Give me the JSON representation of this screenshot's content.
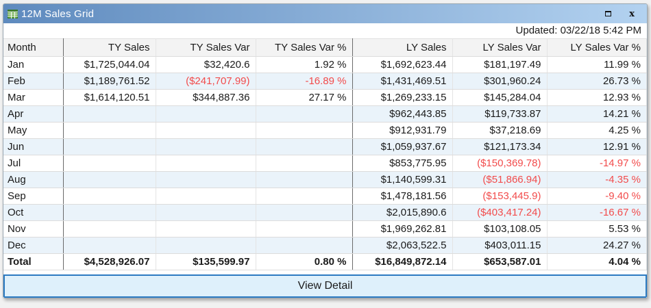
{
  "window": {
    "title": "12M Sales Grid",
    "updated": "Updated: 03/22/18 5:42 PM",
    "view_detail_label": "View Detail",
    "icons": {
      "title_icon": "spreadsheet-grid-icon",
      "maximize_icon": "maximize-icon",
      "close_icon": "close-icon",
      "close_glyph": "x"
    }
  },
  "colors": {
    "titlebar_gradient_start": "#5e8abe",
    "titlebar_gradient_end": "#b3d2f0",
    "negative_text": "#f24b4b",
    "zebra_row_bg": "#eaf3fa",
    "header_row_bg": "#f3f3f3",
    "button_border": "#2b7ac1",
    "button_bg": "#def0fb",
    "group_separator": "#6a6a6a",
    "icon_green": "#3f7d2e"
  },
  "table": {
    "columns": [
      "Month",
      "TY Sales",
      "TY Sales Var",
      "TY Sales Var %",
      "LY Sales",
      "LY Sales Var",
      "LY Sales Var %"
    ],
    "rows": [
      [
        "Jan",
        "$1,725,044.04",
        "$32,420.6",
        "1.92 %",
        "$1,692,623.44",
        "$181,197.49",
        "11.99 %"
      ],
      [
        "Feb",
        "$1,189,761.52",
        "($241,707.99)",
        "-16.89 %",
        "$1,431,469.51",
        "$301,960.24",
        "26.73 %"
      ],
      [
        "Mar",
        "$1,614,120.51",
        "$344,887.36",
        "27.17 %",
        "$1,269,233.15",
        "$145,284.04",
        "12.93 %"
      ],
      [
        "Apr",
        "",
        "",
        "",
        "$962,443.85",
        "$119,733.87",
        "14.21 %"
      ],
      [
        "May",
        "",
        "",
        "",
        "$912,931.79",
        "$37,218.69",
        "4.25 %"
      ],
      [
        "Jun",
        "",
        "",
        "",
        "$1,059,937.67",
        "$121,173.34",
        "12.91 %"
      ],
      [
        "Jul",
        "",
        "",
        "",
        "$853,775.95",
        "($150,369.78)",
        "-14.97 %"
      ],
      [
        "Aug",
        "",
        "",
        "",
        "$1,140,599.31",
        "($51,866.94)",
        "-4.35 %"
      ],
      [
        "Sep",
        "",
        "",
        "",
        "$1,478,181.56",
        "($153,445.9)",
        "-9.40 %"
      ],
      [
        "Oct",
        "",
        "",
        "",
        "$2,015,890.6",
        "($403,417.24)",
        "-16.67 %"
      ],
      [
        "Nov",
        "",
        "",
        "",
        "$1,969,262.81",
        "$103,108.05",
        "5.53 %"
      ],
      [
        "Dec",
        "",
        "",
        "",
        "$2,063,522.5",
        "$403,011.15",
        "24.27 %"
      ]
    ],
    "total_row": [
      "Total",
      "$4,528,926.07",
      "$135,599.97",
      "0.80 %",
      "$16,849,872.14",
      "$653,587.01",
      "4.04 %"
    ]
  }
}
